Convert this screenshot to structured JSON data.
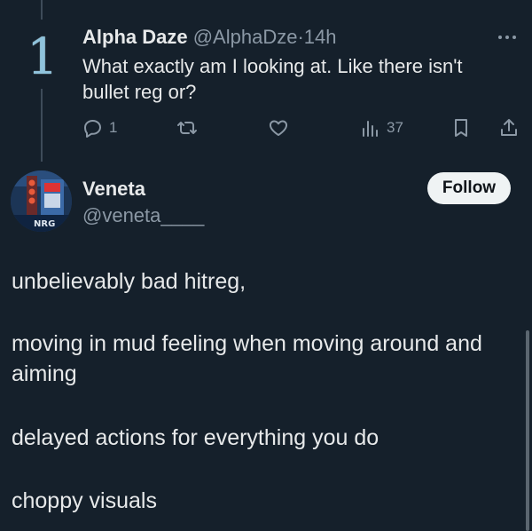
{
  "reply": {
    "avatar_glyph": "1",
    "name": "Alpha Daze",
    "handle": "@AlphaDze",
    "separator": "·",
    "time": "14h",
    "text": "What exactly am I looking at. Like there isn't bullet reg or?",
    "actions": {
      "reply_icon": "comment-icon",
      "reply_count": "1",
      "repost_icon": "repost-icon",
      "like_icon": "heart-icon",
      "views_icon": "views-icon",
      "views_count": "37",
      "bookmark_icon": "bookmark-icon",
      "share_icon": "share-icon"
    },
    "more_icon": "more-icon"
  },
  "post": {
    "author_name": "Veneta",
    "author_handle": "@veneta____",
    "follow_label": "Follow",
    "paragraphs": [
      "unbelievably bad hitreg,",
      "moving in mud feeling when moving around and aiming",
      "delayed actions for everything you do",
      "choppy visuals"
    ],
    "avatar_label": "NRG"
  },
  "colors": {
    "background": "#15202b",
    "text_primary": "#e7e9ea",
    "text_secondary": "#8b98a5",
    "follow_bg": "#eff3f4",
    "thread_line": "#3e4b59"
  }
}
